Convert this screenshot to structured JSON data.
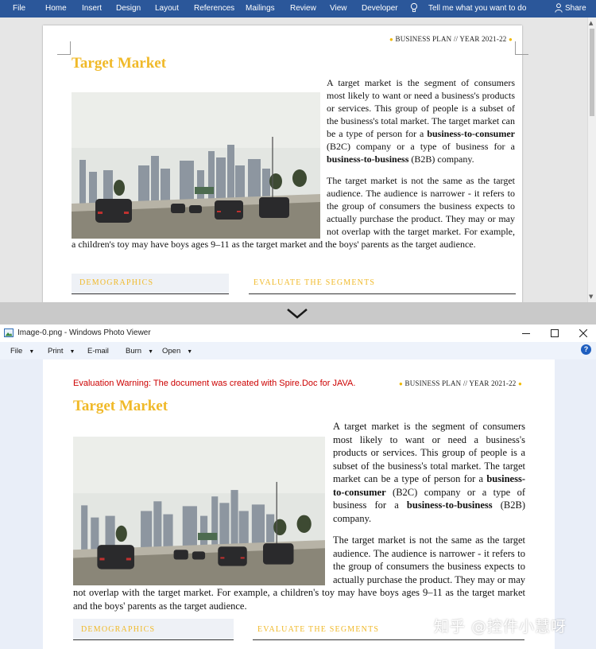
{
  "word": {
    "tabs": [
      "File",
      "Home",
      "Insert",
      "Design",
      "Layout",
      "References",
      "Mailings",
      "Review",
      "View",
      "Developer"
    ],
    "tell_me": "Tell me what you want to do",
    "share": "Share"
  },
  "doc": {
    "header": "BUSINESS PLAN // YEAR 2021-22",
    "title": "Target Market",
    "intro": "A target market is the segment of consumers most likely to want or need a business's products or services. This group of people is a subset of the business's total market. The target market can be a type of person for a ",
    "b2c_bold": "business-to-consumer",
    "b2c_mid": " (B2C) company or a type of business for a ",
    "b2b_bold": "business-to-business",
    "b2b_end": " (B2B) company.",
    "para2": "The target market is not the same as the target audience. The audience is narrower - it refers to the group of consumers the business expects to actually purchase the product. They may or may not overlap with the target market. For example, a children's toy may have boys ages 9–11 as the target market and the boys' parents as the target audience.",
    "section1": "DEMOGRAPHICS",
    "section2": "EVALUATE THE SEGMENTS"
  },
  "viewer": {
    "window_title": "Image-0.png - Windows Photo Viewer",
    "menu": [
      "File",
      "Print",
      "E-mail",
      "Burn",
      "Open"
    ],
    "help": "?",
    "evaluation_warning": "Evaluation Warning: The document was created with Spire.Doc for JAVA.",
    "watermark": "知乎 @控件小慧呀"
  },
  "colors": {
    "ribbon": "#2b579a",
    "title": "#f0b928",
    "warning": "#cc0000"
  }
}
